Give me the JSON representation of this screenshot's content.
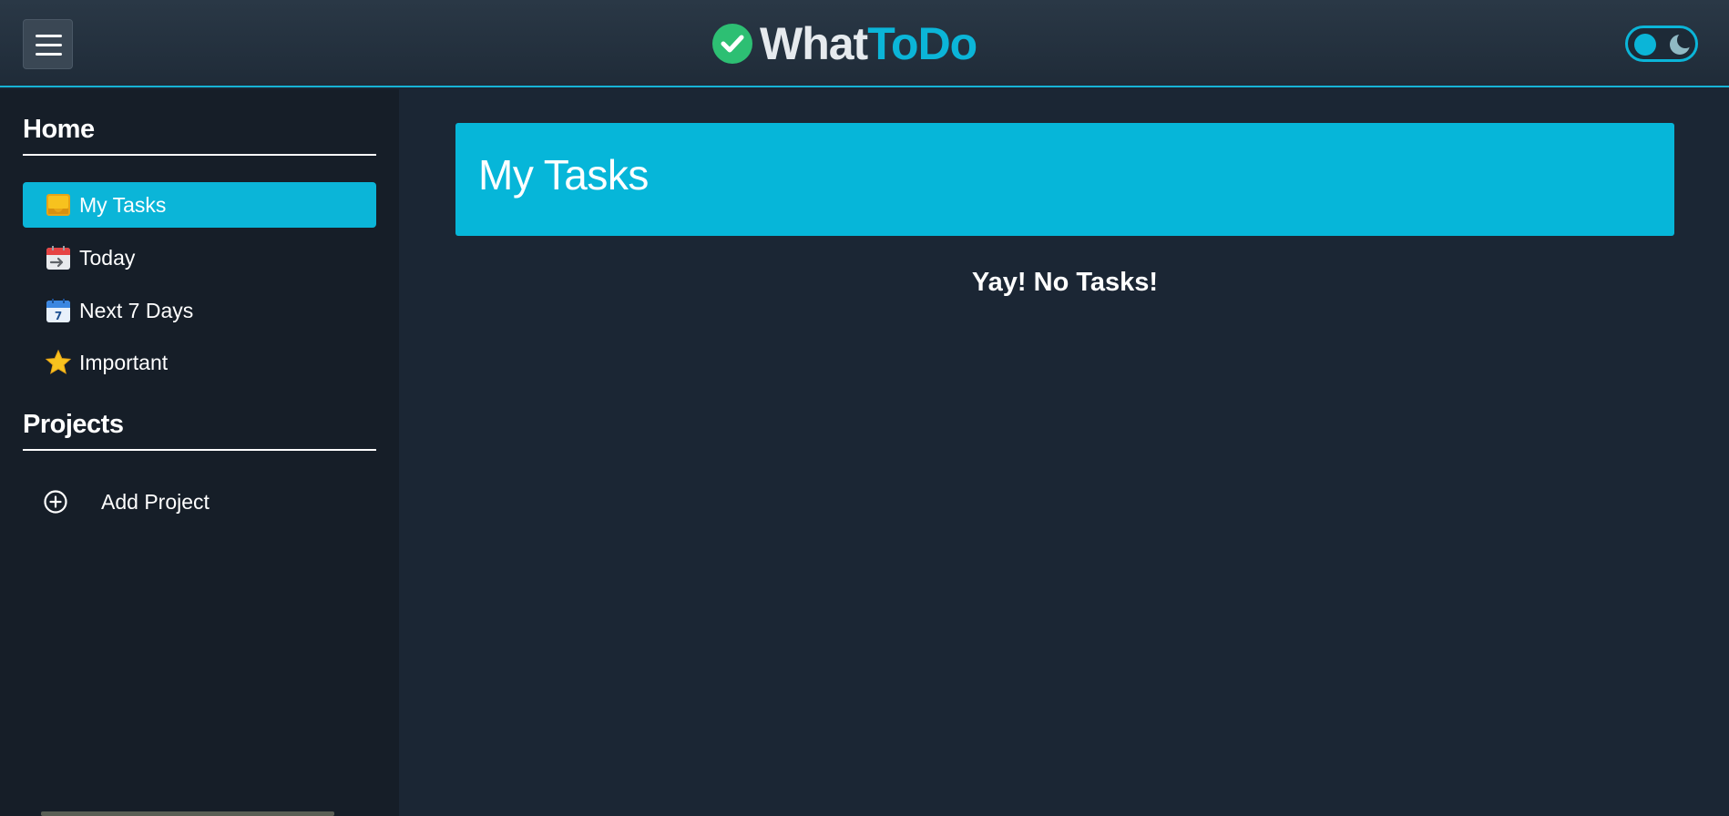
{
  "header": {
    "menu_label": "menu",
    "brand_part1": "What",
    "brand_part2": "ToDo",
    "brand_colors": {
      "what": "#e6eaee",
      "todo": "#0bb5d8",
      "check": "#2dbf73"
    }
  },
  "sidebar": {
    "home_title": "Home",
    "items": [
      {
        "label": "My Tasks",
        "icon": "inbox-tray-icon",
        "active": true
      },
      {
        "label": "Today",
        "icon": "calendar-today-icon",
        "active": false
      },
      {
        "label": "Next 7 Days",
        "icon": "calendar-7-icon",
        "active": false
      },
      {
        "label": "Important",
        "icon": "star-icon",
        "active": false
      }
    ],
    "calendar_day": "7",
    "projects_title": "Projects",
    "add_project_label": "Add Project"
  },
  "main": {
    "title": "My Tasks",
    "empty_message": "Yay! No Tasks!"
  },
  "theme": {
    "accent": "#0bb5d8",
    "background": "#1b2634",
    "sidebar_bg": "#161e28",
    "mode": "dark"
  }
}
